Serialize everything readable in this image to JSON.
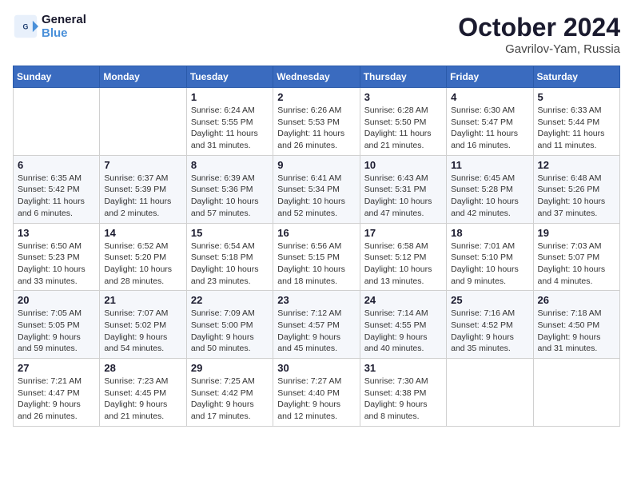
{
  "header": {
    "logo_line1": "General",
    "logo_line2": "Blue",
    "month": "October 2024",
    "location": "Gavrilov-Yam, Russia"
  },
  "weekdays": [
    "Sunday",
    "Monday",
    "Tuesday",
    "Wednesday",
    "Thursday",
    "Friday",
    "Saturday"
  ],
  "weeks": [
    [
      {
        "day": "",
        "sunrise": "",
        "sunset": "",
        "daylight": ""
      },
      {
        "day": "",
        "sunrise": "",
        "sunset": "",
        "daylight": ""
      },
      {
        "day": "1",
        "sunrise": "Sunrise: 6:24 AM",
        "sunset": "Sunset: 5:55 PM",
        "daylight": "Daylight: 11 hours and 31 minutes."
      },
      {
        "day": "2",
        "sunrise": "Sunrise: 6:26 AM",
        "sunset": "Sunset: 5:53 PM",
        "daylight": "Daylight: 11 hours and 26 minutes."
      },
      {
        "day": "3",
        "sunrise": "Sunrise: 6:28 AM",
        "sunset": "Sunset: 5:50 PM",
        "daylight": "Daylight: 11 hours and 21 minutes."
      },
      {
        "day": "4",
        "sunrise": "Sunrise: 6:30 AM",
        "sunset": "Sunset: 5:47 PM",
        "daylight": "Daylight: 11 hours and 16 minutes."
      },
      {
        "day": "5",
        "sunrise": "Sunrise: 6:33 AM",
        "sunset": "Sunset: 5:44 PM",
        "daylight": "Daylight: 11 hours and 11 minutes."
      }
    ],
    [
      {
        "day": "6",
        "sunrise": "Sunrise: 6:35 AM",
        "sunset": "Sunset: 5:42 PM",
        "daylight": "Daylight: 11 hours and 6 minutes."
      },
      {
        "day": "7",
        "sunrise": "Sunrise: 6:37 AM",
        "sunset": "Sunset: 5:39 PM",
        "daylight": "Daylight: 11 hours and 2 minutes."
      },
      {
        "day": "8",
        "sunrise": "Sunrise: 6:39 AM",
        "sunset": "Sunset: 5:36 PM",
        "daylight": "Daylight: 10 hours and 57 minutes."
      },
      {
        "day": "9",
        "sunrise": "Sunrise: 6:41 AM",
        "sunset": "Sunset: 5:34 PM",
        "daylight": "Daylight: 10 hours and 52 minutes."
      },
      {
        "day": "10",
        "sunrise": "Sunrise: 6:43 AM",
        "sunset": "Sunset: 5:31 PM",
        "daylight": "Daylight: 10 hours and 47 minutes."
      },
      {
        "day": "11",
        "sunrise": "Sunrise: 6:45 AM",
        "sunset": "Sunset: 5:28 PM",
        "daylight": "Daylight: 10 hours and 42 minutes."
      },
      {
        "day": "12",
        "sunrise": "Sunrise: 6:48 AM",
        "sunset": "Sunset: 5:26 PM",
        "daylight": "Daylight: 10 hours and 37 minutes."
      }
    ],
    [
      {
        "day": "13",
        "sunrise": "Sunrise: 6:50 AM",
        "sunset": "Sunset: 5:23 PM",
        "daylight": "Daylight: 10 hours and 33 minutes."
      },
      {
        "day": "14",
        "sunrise": "Sunrise: 6:52 AM",
        "sunset": "Sunset: 5:20 PM",
        "daylight": "Daylight: 10 hours and 28 minutes."
      },
      {
        "day": "15",
        "sunrise": "Sunrise: 6:54 AM",
        "sunset": "Sunset: 5:18 PM",
        "daylight": "Daylight: 10 hours and 23 minutes."
      },
      {
        "day": "16",
        "sunrise": "Sunrise: 6:56 AM",
        "sunset": "Sunset: 5:15 PM",
        "daylight": "Daylight: 10 hours and 18 minutes."
      },
      {
        "day": "17",
        "sunrise": "Sunrise: 6:58 AM",
        "sunset": "Sunset: 5:12 PM",
        "daylight": "Daylight: 10 hours and 13 minutes."
      },
      {
        "day": "18",
        "sunrise": "Sunrise: 7:01 AM",
        "sunset": "Sunset: 5:10 PM",
        "daylight": "Daylight: 10 hours and 9 minutes."
      },
      {
        "day": "19",
        "sunrise": "Sunrise: 7:03 AM",
        "sunset": "Sunset: 5:07 PM",
        "daylight": "Daylight: 10 hours and 4 minutes."
      }
    ],
    [
      {
        "day": "20",
        "sunrise": "Sunrise: 7:05 AM",
        "sunset": "Sunset: 5:05 PM",
        "daylight": "Daylight: 9 hours and 59 minutes."
      },
      {
        "day": "21",
        "sunrise": "Sunrise: 7:07 AM",
        "sunset": "Sunset: 5:02 PM",
        "daylight": "Daylight: 9 hours and 54 minutes."
      },
      {
        "day": "22",
        "sunrise": "Sunrise: 7:09 AM",
        "sunset": "Sunset: 5:00 PM",
        "daylight": "Daylight: 9 hours and 50 minutes."
      },
      {
        "day": "23",
        "sunrise": "Sunrise: 7:12 AM",
        "sunset": "Sunset: 4:57 PM",
        "daylight": "Daylight: 9 hours and 45 minutes."
      },
      {
        "day": "24",
        "sunrise": "Sunrise: 7:14 AM",
        "sunset": "Sunset: 4:55 PM",
        "daylight": "Daylight: 9 hours and 40 minutes."
      },
      {
        "day": "25",
        "sunrise": "Sunrise: 7:16 AM",
        "sunset": "Sunset: 4:52 PM",
        "daylight": "Daylight: 9 hours and 35 minutes."
      },
      {
        "day": "26",
        "sunrise": "Sunrise: 7:18 AM",
        "sunset": "Sunset: 4:50 PM",
        "daylight": "Daylight: 9 hours and 31 minutes."
      }
    ],
    [
      {
        "day": "27",
        "sunrise": "Sunrise: 7:21 AM",
        "sunset": "Sunset: 4:47 PM",
        "daylight": "Daylight: 9 hours and 26 minutes."
      },
      {
        "day": "28",
        "sunrise": "Sunrise: 7:23 AM",
        "sunset": "Sunset: 4:45 PM",
        "daylight": "Daylight: 9 hours and 21 minutes."
      },
      {
        "day": "29",
        "sunrise": "Sunrise: 7:25 AM",
        "sunset": "Sunset: 4:42 PM",
        "daylight": "Daylight: 9 hours and 17 minutes."
      },
      {
        "day": "30",
        "sunrise": "Sunrise: 7:27 AM",
        "sunset": "Sunset: 4:40 PM",
        "daylight": "Daylight: 9 hours and 12 minutes."
      },
      {
        "day": "31",
        "sunrise": "Sunrise: 7:30 AM",
        "sunset": "Sunset: 4:38 PM",
        "daylight": "Daylight: 9 hours and 8 minutes."
      },
      {
        "day": "",
        "sunrise": "",
        "sunset": "",
        "daylight": ""
      },
      {
        "day": "",
        "sunrise": "",
        "sunset": "",
        "daylight": ""
      }
    ]
  ]
}
